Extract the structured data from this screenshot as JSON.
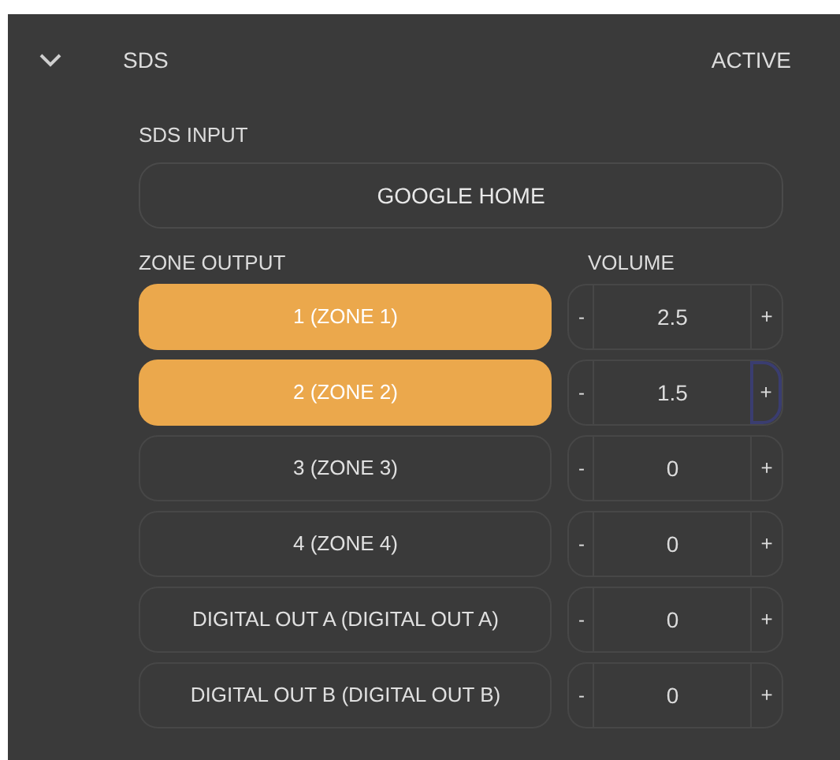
{
  "section": {
    "title": "SDS",
    "status": "ACTIVE",
    "expanded": true
  },
  "input": {
    "label": "SDS INPUT",
    "value": "GOOGLE HOME"
  },
  "zone_header": "ZONE OUTPUT",
  "volume_header": "VOLUME",
  "zones": [
    {
      "name": "1 (ZONE 1)",
      "selected": true,
      "minus": "-",
      "volume": "2.5",
      "plus": "+",
      "plus_focused": false
    },
    {
      "name": "2 (ZONE 2)",
      "selected": true,
      "minus": "-",
      "volume": "1.5",
      "plus": "+",
      "plus_focused": true
    },
    {
      "name": "3 (ZONE 3)",
      "selected": false,
      "minus": "-",
      "volume": "0",
      "plus": "+",
      "plus_focused": false
    },
    {
      "name": "4 (ZONE 4)",
      "selected": false,
      "minus": "-",
      "volume": "0",
      "plus": "+",
      "plus_focused": false
    },
    {
      "name": "DIGITAL OUT A (DIGITAL OUT A)",
      "selected": false,
      "minus": "-",
      "volume": "0",
      "plus": "+",
      "plus_focused": false
    },
    {
      "name": "DIGITAL OUT B (DIGITAL OUT B)",
      "selected": false,
      "minus": "-",
      "volume": "0",
      "plus": "+",
      "plus_focused": false
    }
  ]
}
